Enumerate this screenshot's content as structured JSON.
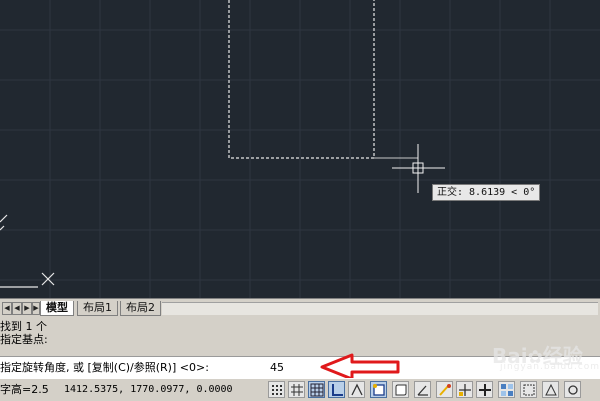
{
  "canvas": {
    "ortho_tooltip": "正交: 8.6139 < 0°",
    "background_color": "#212830",
    "grid_color": "#2e3641"
  },
  "layout_tabs": {
    "tabs": [
      {
        "label": "模型",
        "active": true
      },
      {
        "label": "布局1",
        "active": false
      },
      {
        "label": "布局2",
        "active": false
      }
    ]
  },
  "command": {
    "history": [
      "找到 1 个",
      "指定基点:"
    ],
    "prompt": "指定旋转角度, 或 [复制(C)/参照(R)] <0>:",
    "input_value": "45",
    "arrow_color": "#e0191b"
  },
  "watermark": {
    "text": "Bai",
    "text2": "经验",
    "sub": "jingyan.baidu.com"
  },
  "status_bar": {
    "left_text": "字高=2.5",
    "coordinates": "1412.5375, 1770.0977, 0.0000",
    "tools": [
      "snap-icon",
      "grid-icon",
      "ortho-icon",
      "polar-icon",
      "osnap-icon",
      "otrack-icon",
      "ducs-icon",
      "dyn-icon",
      "lineweight-icon",
      "tpy-icon",
      "qp-icon",
      "sc-icon"
    ]
  }
}
